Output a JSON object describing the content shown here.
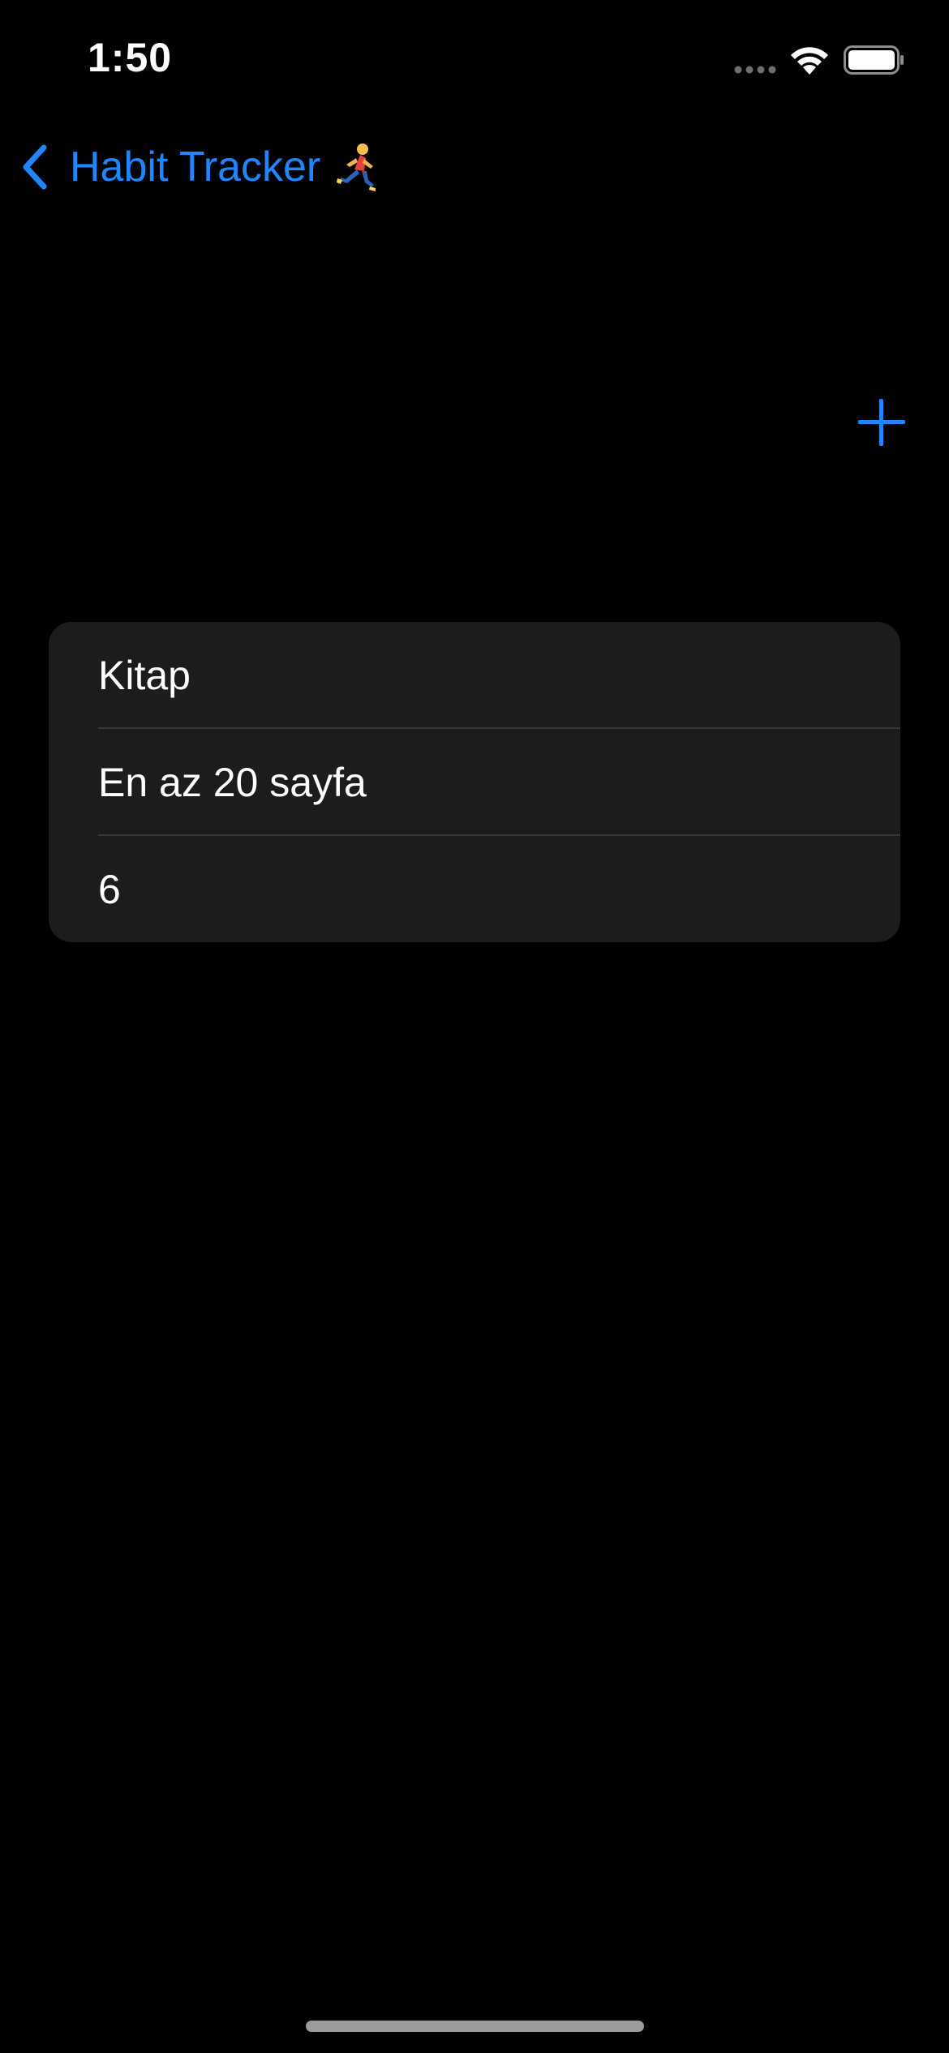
{
  "status_bar": {
    "time": "1:50",
    "signal_icon": "cellular-signal-icon",
    "wifi_icon": "wifi-icon",
    "battery_icon": "battery-icon"
  },
  "navigation": {
    "back_label": "Habit Tracker",
    "back_icon": "chevron-left-icon",
    "title_emoji_icon": "runner-emoji-icon",
    "add_icon": "plus-icon",
    "accent_color": "#1f86ff"
  },
  "habit": {
    "name": "Kitap",
    "description": "En az 20 sayfa",
    "count": "6"
  },
  "colors": {
    "background": "#000000",
    "card": "#1c1c1e",
    "text": "#ffffff",
    "divider": "#38383a"
  }
}
